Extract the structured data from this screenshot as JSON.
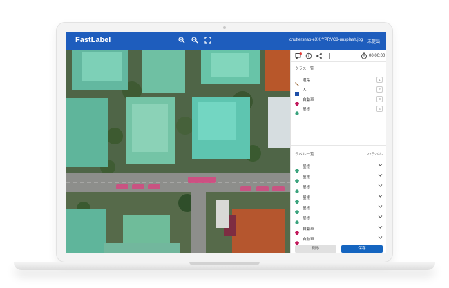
{
  "app": {
    "logo": "FastLabel",
    "filename": "chuttersnap-eXKrYPRVC8-unsplash.jpg",
    "hold_link": "未提出"
  },
  "toolbar_icons": [
    "zoom-in-icon",
    "zoom-out-icon",
    "fullscreen-icon"
  ],
  "panel_tools": [
    "comment-icon",
    "info-icon",
    "share-icon",
    "more-icon"
  ],
  "timer": "00:00:00",
  "classes": {
    "title": "クラス一覧",
    "items": [
      {
        "label": "道路",
        "key": "1",
        "shape": "line",
        "color": "#9a6a3a"
      },
      {
        "label": "人",
        "key": "2",
        "shape": "square",
        "color": "#1e4fa8"
      },
      {
        "label": "自動車",
        "key": "3",
        "shape": "pentagon",
        "color": "#c2185b"
      },
      {
        "label": "屋根",
        "key": "4",
        "shape": "pentagon",
        "color": "#3aa37d"
      }
    ]
  },
  "labels": {
    "title": "ラベル一覧",
    "count": "22ラベル",
    "items": [
      {
        "label": "屋根",
        "color": "#3aa37d"
      },
      {
        "label": "屋根",
        "color": "#3aa37d"
      },
      {
        "label": "屋根",
        "color": "#3aa37d"
      },
      {
        "label": "屋根",
        "color": "#3aa37d"
      },
      {
        "label": "屋根",
        "color": "#3aa37d"
      },
      {
        "label": "屋根",
        "color": "#3aa37d"
      },
      {
        "label": "自動車",
        "color": "#c2185b"
      },
      {
        "label": "自動車",
        "color": "#c2185b"
      }
    ]
  },
  "buttons": {
    "close": "閉る",
    "save": "保存"
  },
  "colors": {
    "header": "#1e5dbd",
    "accent": "#1565c0",
    "roof_overlay": "#5fd3b0",
    "car_overlay": "#e0407a"
  }
}
